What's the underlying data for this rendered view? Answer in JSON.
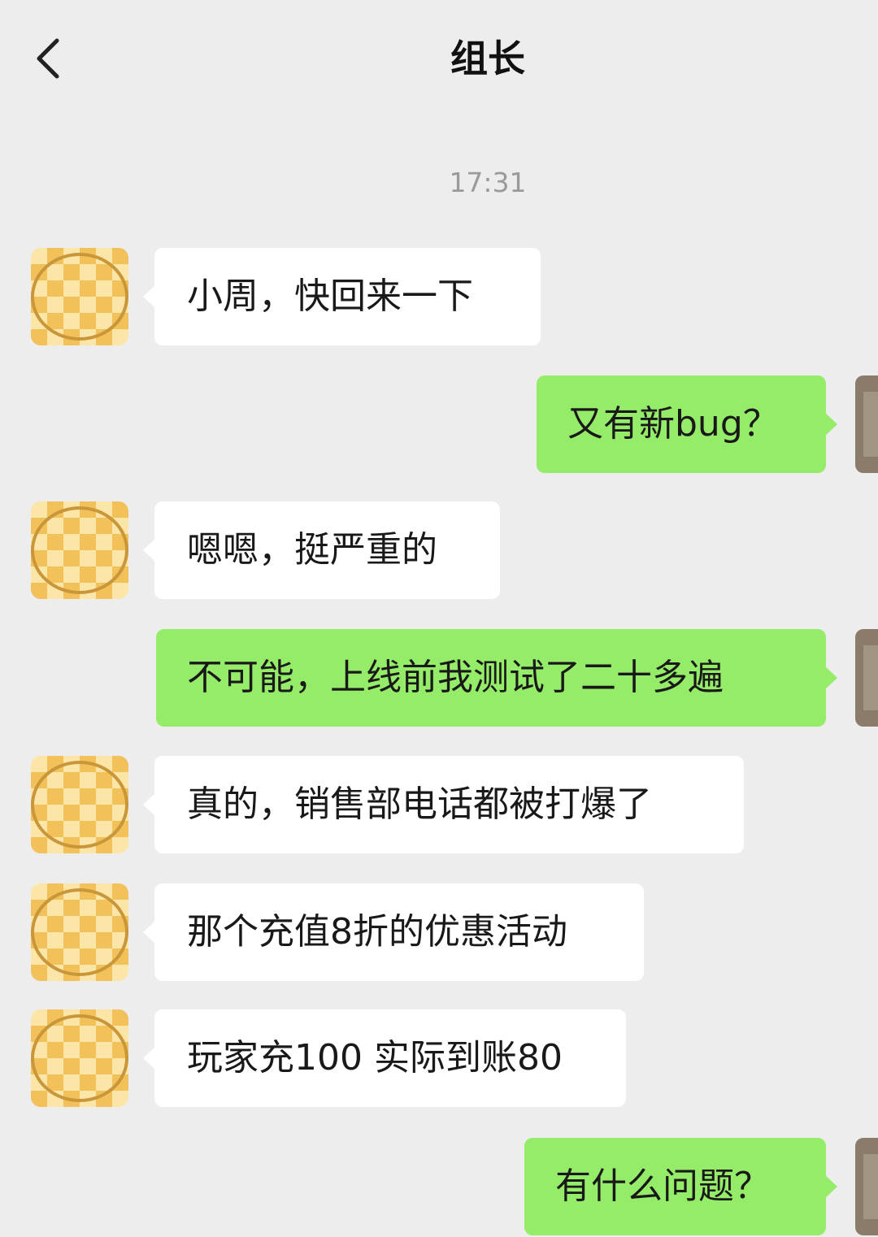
{
  "header": {
    "title": "组长",
    "back_icon": "chevron-left-icon"
  },
  "timestamp": "17:31",
  "colors": {
    "background": "#ededed",
    "incoming_bubble": "#ffffff",
    "outgoing_bubble": "#95ec69"
  },
  "messages": [
    {
      "direction": "in",
      "text": "小周，快回来一下"
    },
    {
      "direction": "out",
      "text": "又有新bug？"
    },
    {
      "direction": "in",
      "text": "嗯嗯，挺严重的"
    },
    {
      "direction": "out",
      "text": "不可能，上线前我测试了二十多遍"
    },
    {
      "direction": "in",
      "text": "真的，销售部电话都被打爆了"
    },
    {
      "direction": "in",
      "text": "那个充值8折的优惠活动"
    },
    {
      "direction": "in",
      "text": "玩家充100 实际到账80"
    },
    {
      "direction": "out",
      "text": "有什么问题？"
    }
  ]
}
